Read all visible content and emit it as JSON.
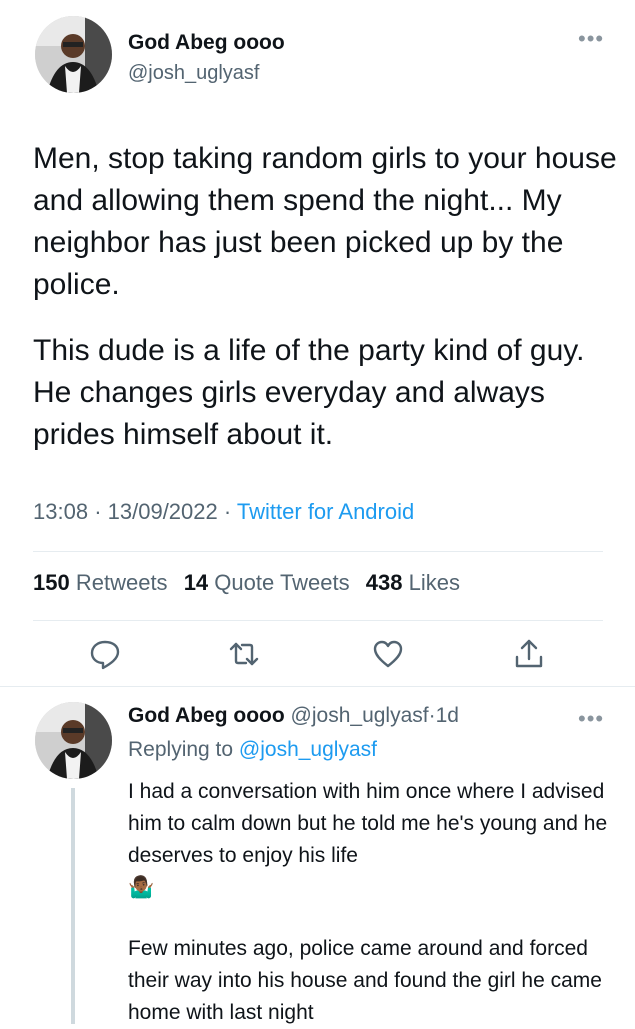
{
  "main_tweet": {
    "author_name": "God Abeg oooo",
    "author_handle": "@josh_uglyasf",
    "more_icon": "ellipsis-icon",
    "paragraph1": "Men, stop taking random girls to your house and allowing them spend the night... My neighbor has just been picked up by the police.",
    "paragraph2": "This dude is a life of the party kind of guy. He changes girls everyday and always prides himself about it.",
    "time": "13:08",
    "date": "13/09/2022",
    "separator": "·",
    "source": "Twitter for Android",
    "stats": {
      "retweets_count": "150",
      "retweets_label": "Retweets",
      "quotes_count": "14",
      "quotes_label": "Quote Tweets",
      "likes_count": "438",
      "likes_label": "Likes"
    },
    "actions": [
      "reply-icon",
      "retweet-icon",
      "like-icon",
      "share-icon"
    ]
  },
  "reply_tweet": {
    "author_name": "God Abeg oooo",
    "author_handle": "@josh_uglyasf",
    "age": "1d",
    "separator": "·",
    "replying_label": "Replying to",
    "replying_handle": "@josh_uglyasf",
    "paragraph1": "I had a conversation with him once where I advised him to calm down but he told me he's young and he deserves to enjoy his life",
    "emoji": "🤷🏾‍♂️",
    "paragraph2": "Few minutes ago, police came around and forced their way into his house and found the girl he came home with last night"
  },
  "colors": {
    "text": "#0f1419",
    "secondary": "#536471",
    "link": "#1d9bf0",
    "divider": "#e6ecf0"
  }
}
